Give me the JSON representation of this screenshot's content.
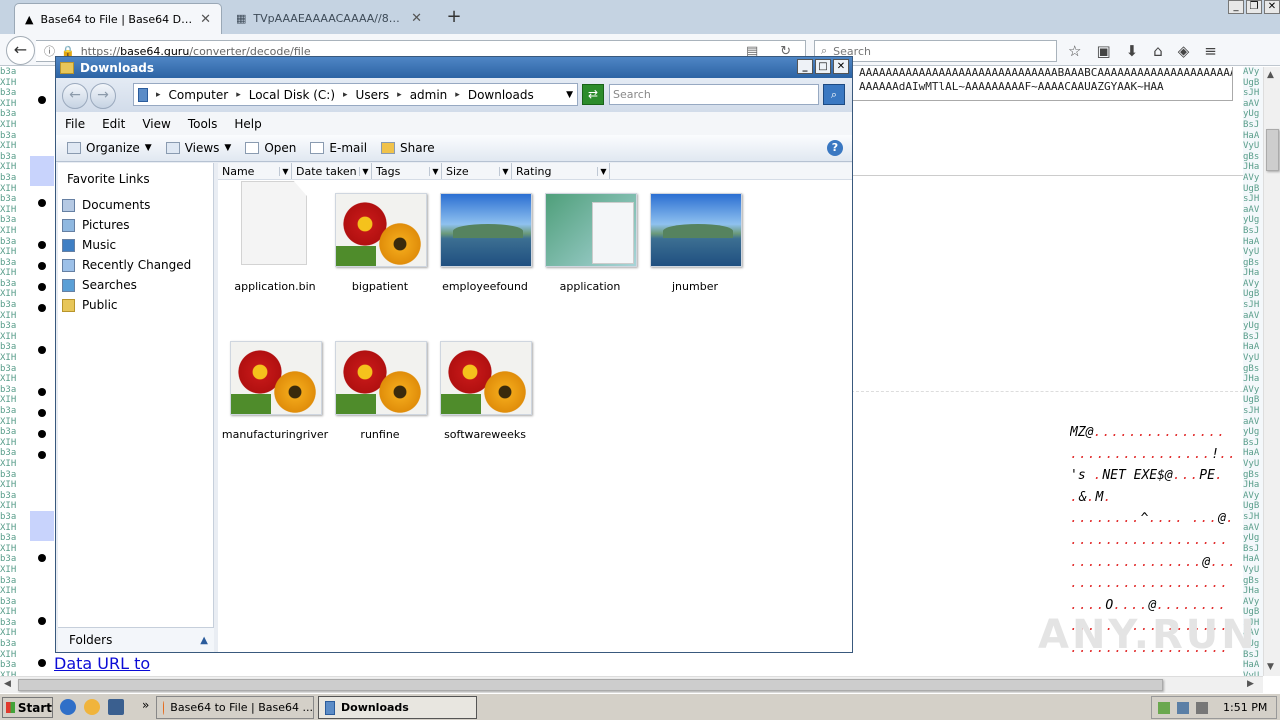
{
  "browser": {
    "tabs": [
      {
        "title": "Base64 to File | Base64 Deco...",
        "active": true
      },
      {
        "title": "TVpAAAEAAAACAAAA//8AAL...",
        "active": false
      }
    ],
    "url_prefix": "https://",
    "url_host": "base64.guru",
    "url_path": "/converter/decode/file",
    "search_placeholder": "Search",
    "new_tab_symbol": "+"
  },
  "page": {
    "textarea_line1": "AAAAAAAAAAAAAAAAAAAAAAAAAAAAAABAAABCAAAAAAAAAAAAAAAAAAAAAAAA",
    "textarea_line2": "AAAAAAdAIwMTlAL~AAAAAAAAAF~AAAACAAUAZGYAAK~HAA",
    "left_strip": "b3aXIHb3aXIHb3aXIHb3aXIHb3aXIHb3aXIHb3aXIHb3aXIHb3aXIHb3aXIHb3aXIHb3aXIHb3aXIHb3aXIHb3aXIHb3aXIHb3aXIHb3aXIHb3aXIHb3aXIHb3aXIHb3aXIHb3aXIHb3aXIHb3aXIHb3aXIHb3aXIHb3aXIHb3aXIHb3aXIHb3aXIHb3aXIHb3aXIHb3aXIHb3aXIHb3aXIHb3aXIHb3aXIHb3aXIHb3aXIHb3aXIHb3aXIHb3aXIHb3aXIHb3aXIHb3aXIHb3aXIHb3aXIHb3aXIHb3aXIHb3aXIHb3aXIHb3aXIHb3aXIHb3aXIHb3aXIHb3aXIHb3aXIHb3aXIHb3aXIHb3aXIHb3aXIHb3aXIHb3aXIHb3aXIH",
    "right_strip": "AVyUgBsJHaAVyUgBsJHaAVyUgBsJHaAVyUgBsJHaAVyUgBsJHaAVyUgBsJHaAVyUgBsJHaAVyUgBsJHaAVyUgBsJHaAVyUgBsJHaAVyUgBsJHaAVyUgBsJHaAVyUgBsJHaAVyUgBsJHaAVyUgBsJHaAVyUgBsJHaAVyUgBsJHaAVyUgBsJHaAVyUgBsJHaAVyUgBsJHaAVyUgBsJHaAVyUgBsJHaAVyUgBsJHaAVyUgBsJHaAVyUgBsJHaAVyUgBsJHaAVyUgBsJHaAVyUgBsJHaAVyUgBsJHaAVyUgBsJHaAVyUgBsJHaAVyUgBsJHaAVyUgBsJHaAVyUgBsJHaAVyUgBsJHaAVyUgBsJHaAVyUgBsJHaAVyUgBsJHaAVyUgBsJHaAVyUgBsJHaAVyUgBsJH",
    "hex_lines": [
      "MZ@...............",
      "................!..",
      "'s .NET EXE$@...PE.",
      ".&.M.",
      "........^.... ...@.",
      "..................",
      "...............@...",
      "..................",
      "....O....@........",
      "..................",
      ".................."
    ],
    "data_url_link": "Data URL to",
    "watermark": "ANY.RUN"
  },
  "explorer": {
    "title": "Downloads",
    "breadcrumb": [
      "Computer",
      "Local Disk (C:)",
      "Users",
      "admin",
      "Downloads"
    ],
    "search_placeholder": "Search",
    "menu": [
      "File",
      "Edit",
      "View",
      "Tools",
      "Help"
    ],
    "commands": [
      "Organize",
      "Views",
      "Open",
      "E-mail",
      "Share"
    ],
    "favorites_header": "Favorite Links",
    "favorites": [
      "Documents",
      "Pictures",
      "Music",
      "Recently Changed",
      "Searches",
      "Public"
    ],
    "folders_label": "Folders",
    "columns": [
      "Name",
      "Date taken",
      "Tags",
      "Size",
      "Rating"
    ],
    "files": [
      {
        "name": "application.bin",
        "thumb": "blank"
      },
      {
        "name": "bigpatient",
        "thumb": "flower"
      },
      {
        "name": "employeefound",
        "thumb": "land"
      },
      {
        "name": "application",
        "thumb": "app"
      },
      {
        "name": "jnumber",
        "thumb": "land"
      },
      {
        "name": "manufacturingriver",
        "thumb": "flower"
      },
      {
        "name": "runfine",
        "thumb": "flower"
      },
      {
        "name": "softwareweeks",
        "thumb": "flower"
      }
    ]
  },
  "taskbar": {
    "start_label": "Start",
    "buttons": [
      "Base64 to File | Base64 ...",
      "Downloads"
    ],
    "clock": "1:51 PM"
  }
}
